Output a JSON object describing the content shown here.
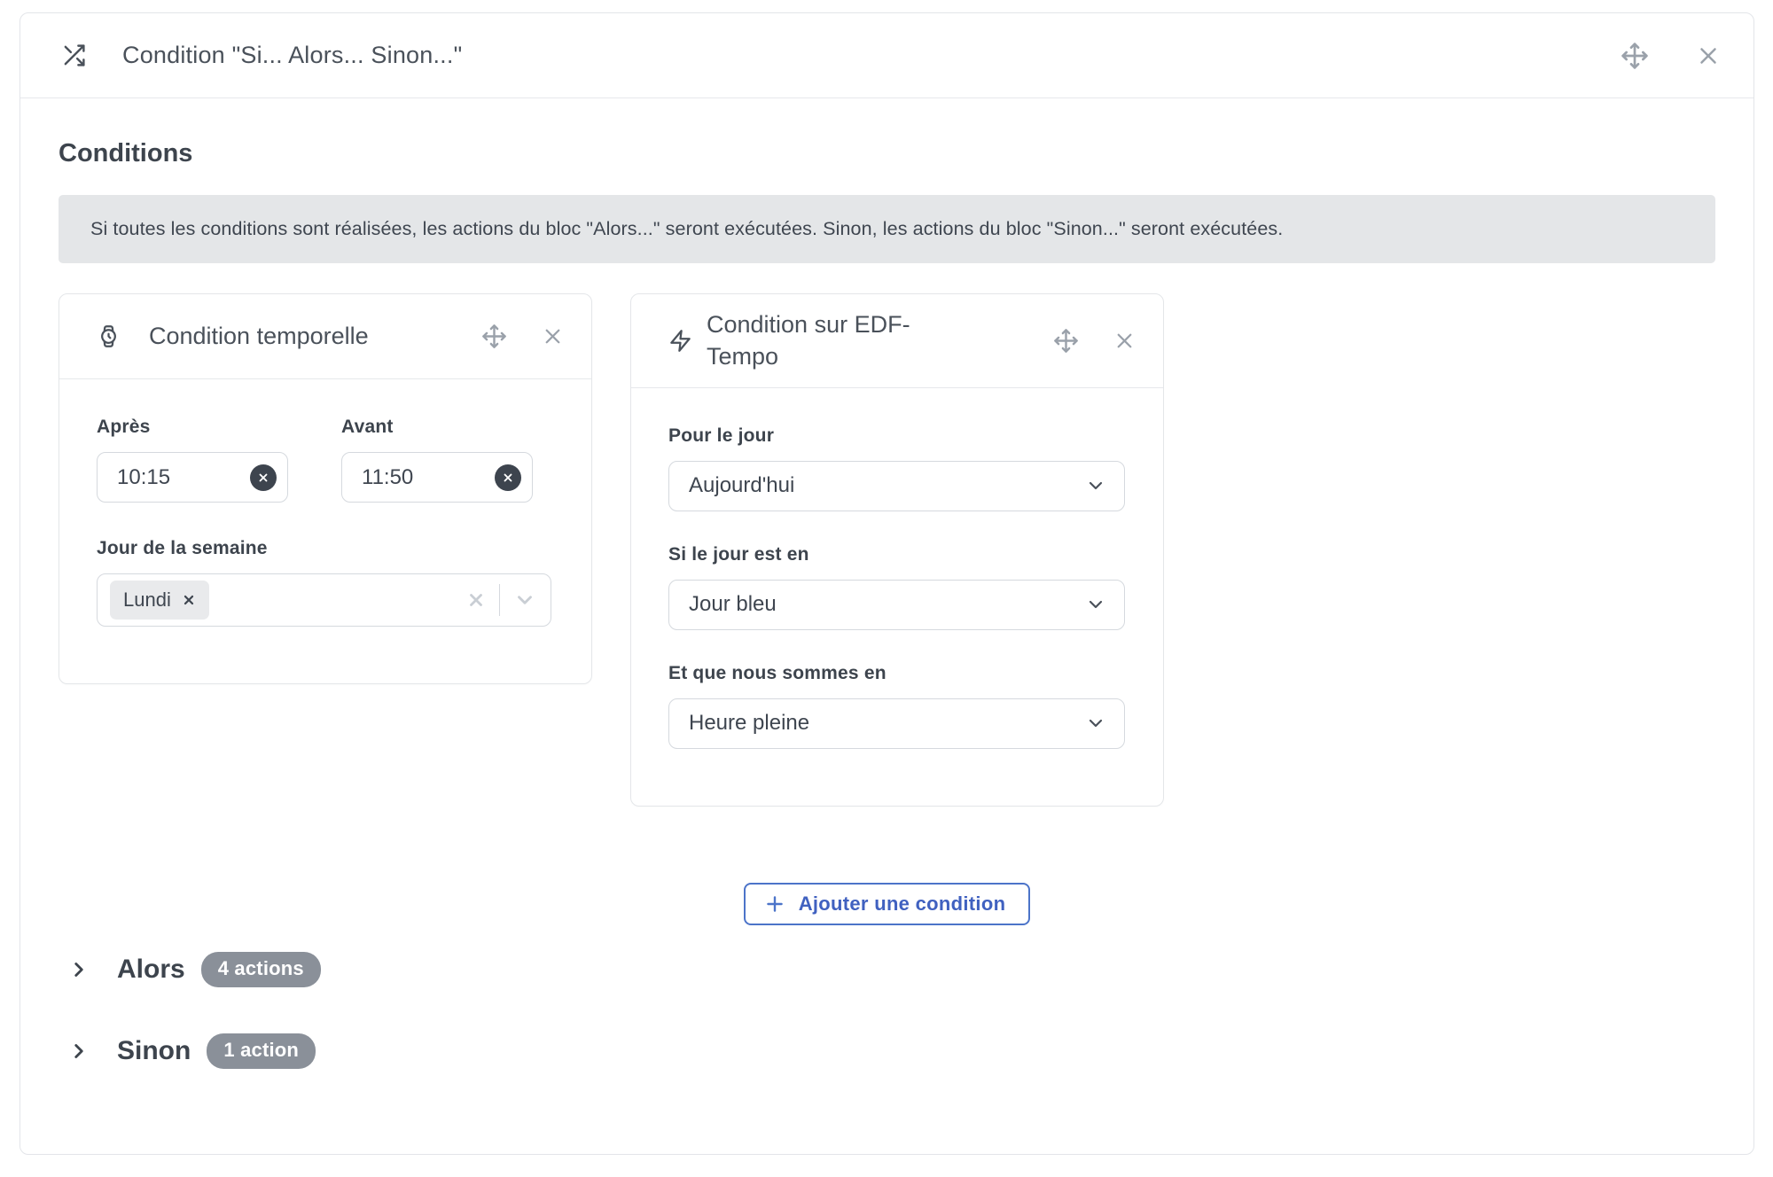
{
  "dialog": {
    "title": "Condition \"Si... Alors... Sinon...\""
  },
  "conditions_section": {
    "heading": "Conditions",
    "info_text": "Si toutes les conditions sont réalisées, les actions du bloc \"Alors...\" seront exécutées. Sinon, les actions du bloc \"Sinon...\" seront exécutées."
  },
  "cards": [
    {
      "title": "Condition temporelle",
      "icon": "watch-icon",
      "after_label": "Après",
      "after_value": "10:15",
      "before_label": "Avant",
      "before_value": "11:50",
      "weekday_label": "Jour de la semaine",
      "weekday_tags": [
        "Lundi"
      ]
    },
    {
      "title": "Condition sur EDF-Tempo",
      "icon": "zap-icon",
      "selects": [
        {
          "label": "Pour le jour",
          "value": "Aujourd'hui"
        },
        {
          "label": "Si le jour est en",
          "value": "Jour bleu"
        },
        {
          "label": "Et que nous sommes en",
          "value": "Heure pleine"
        }
      ]
    }
  ],
  "add_condition": {
    "label": "Ajouter une condition"
  },
  "branches": [
    {
      "label": "Alors",
      "badge": "4 actions"
    },
    {
      "label": "Sinon",
      "badge": "1 action"
    }
  ],
  "colors": {
    "accent_blue": "#4c74c9",
    "badge_gray": "#8a9099",
    "info_bg": "#e4e6e8",
    "dark_chip": "#3d444e",
    "border": "#d5d9de"
  },
  "icons": [
    "shuffle-icon",
    "move-icon",
    "close-icon",
    "watch-icon",
    "zap-icon",
    "clear-circle-icon",
    "tag-remove-icon",
    "chevron-down-icon",
    "chevron-right-icon",
    "plus-icon"
  ]
}
